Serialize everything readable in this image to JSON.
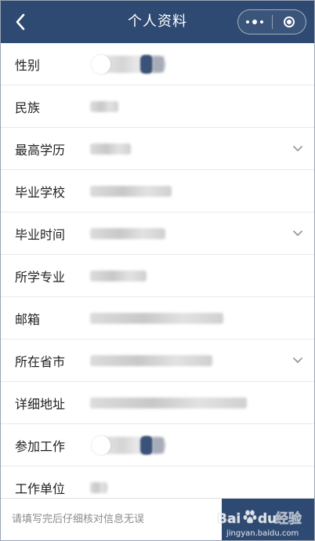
{
  "header": {
    "title": "个人资料",
    "back_icon": "chevron-left-icon",
    "more_icon": "more-dots-icon",
    "close_icon": "target-circle-icon",
    "background": "#2e4a72"
  },
  "rows": [
    {
      "label": "性别",
      "value_type": "toggle"
    },
    {
      "label": "民族",
      "value_type": "blurred-text"
    },
    {
      "label": "最高学历",
      "value_type": "blurred-text",
      "has_dropdown": true
    },
    {
      "label": "毕业学校",
      "value_type": "blurred-text"
    },
    {
      "label": "毕业时间",
      "value_type": "blurred-text",
      "has_dropdown": true
    },
    {
      "label": "所学专业",
      "value_type": "blurred-text"
    },
    {
      "label": "邮箱",
      "value_type": "blurred-text"
    },
    {
      "label": "所在省市",
      "value_type": "blurred-text",
      "has_dropdown": true
    },
    {
      "label": "详细地址",
      "value_type": "blurred-text"
    },
    {
      "label": "参加工作",
      "value_type": "toggle"
    },
    {
      "label": "工作单位",
      "value_type": "blurred-text"
    }
  ],
  "footer": {
    "hint": "请填写完后仔细核对信息无误",
    "button_label": "",
    "accent": "#2e4a72"
  },
  "watermark": {
    "brand": "Baidu经验",
    "url": "jingyan.baidu.com"
  }
}
